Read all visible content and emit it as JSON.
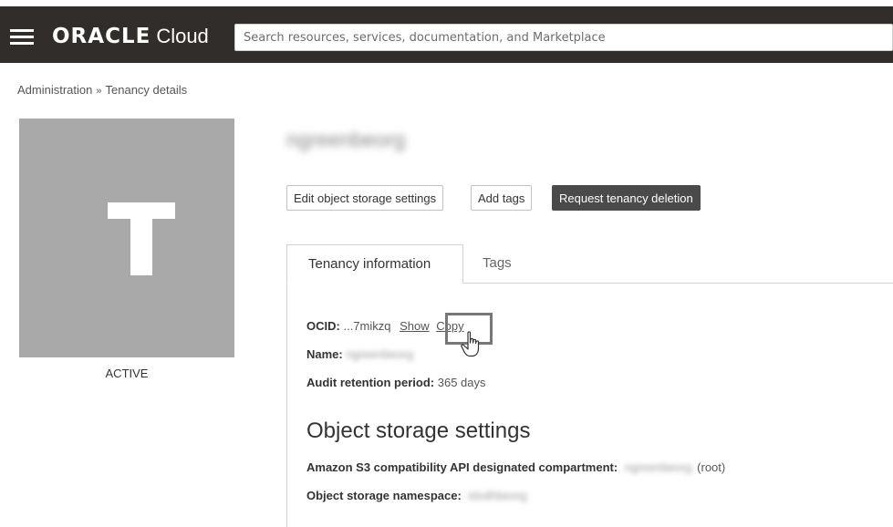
{
  "header": {
    "brand": "ORACLE",
    "product": "Cloud",
    "search_placeholder": "Search resources, services, documentation, and Marketplace"
  },
  "breadcrumb": {
    "items": [
      "Administration",
      "Tenancy details"
    ],
    "separator": "»"
  },
  "tenancy": {
    "avatar_letter": "T",
    "status": "ACTIVE",
    "name_redacted": "ngreenbeorg"
  },
  "actions": {
    "edit_object_storage": "Edit object storage settings",
    "add_tags": "Add tags",
    "request_deletion": "Request tenancy deletion"
  },
  "tabs": {
    "tenancy_information": "Tenancy information",
    "tags": "Tags"
  },
  "info": {
    "ocid_label": "OCID:",
    "ocid_value": "...7mikzq",
    "show_link": "Show",
    "copy_link": "Copy",
    "name_label": "Name:",
    "name_value": "ngreenbeorg",
    "audit_label": "Audit retention period:",
    "audit_value": "365 days"
  },
  "object_storage": {
    "title": "Object storage settings",
    "s3_label": "Amazon S3 compatibility API designated compartment:",
    "s3_value": "ngreenbeorg",
    "s3_suffix": "(root)",
    "namespace_label": "Object storage namespace:",
    "namespace_value": "idxdhbeorg"
  },
  "icons": {
    "menu": "hamburger-menu-icon",
    "pointer": "hand-pointer-icon"
  },
  "colors": {
    "header_bg": "#312d2a",
    "avatar_bg": "#a9a9a9",
    "primary_button": "#4a4a4a"
  }
}
